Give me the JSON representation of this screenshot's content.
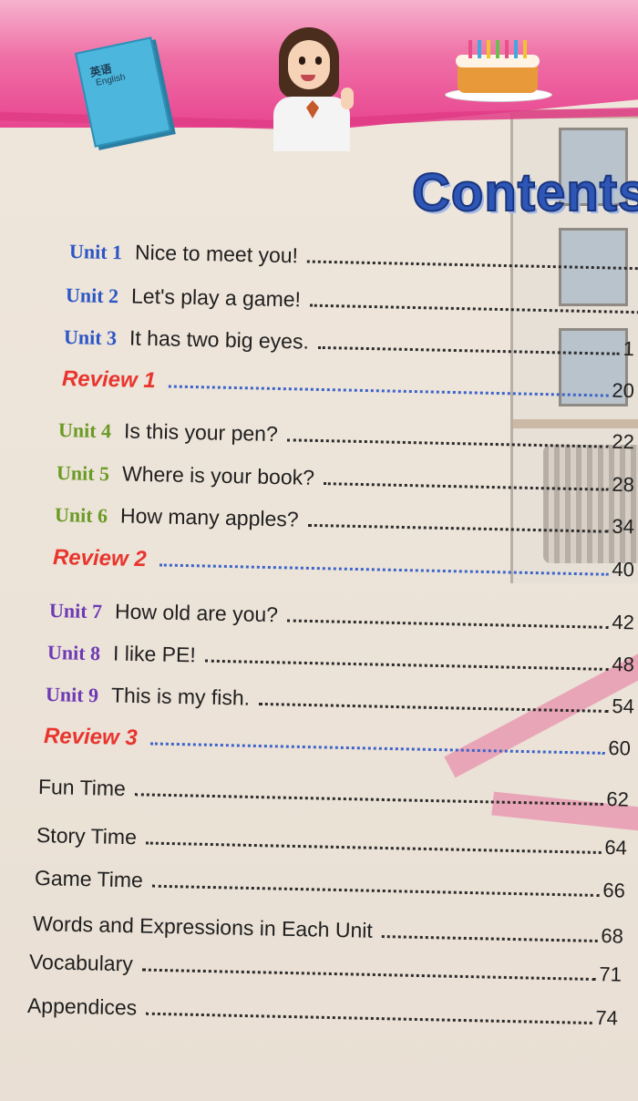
{
  "header": {
    "book_cover_title": "英语",
    "book_cover_subtitle": "English"
  },
  "title": "Contents",
  "toc": [
    {
      "label": "Unit 1",
      "title": "Nice to meet you!",
      "page": ""
    },
    {
      "label": "Unit 2",
      "title": "Let's play a game!",
      "page": ""
    },
    {
      "label": "Unit 3",
      "title": "It has two big eyes.",
      "page": "1"
    },
    {
      "label": "Review 1",
      "title": "",
      "page": "20"
    },
    {
      "label": "Unit 4",
      "title": "Is this your pen?",
      "page": "22"
    },
    {
      "label": "Unit 5",
      "title": "Where is your book?",
      "page": "28"
    },
    {
      "label": "Unit 6",
      "title": "How many apples?",
      "page": "34"
    },
    {
      "label": "Review 2",
      "title": "",
      "page": "40"
    },
    {
      "label": "Unit 7",
      "title": "How old are you?",
      "page": "42"
    },
    {
      "label": "Unit 8",
      "title": "I like PE!",
      "page": "48"
    },
    {
      "label": "Unit 9",
      "title": "This is my fish.",
      "page": "54"
    },
    {
      "label": "Review 3",
      "title": "",
      "page": "60"
    },
    {
      "label": "",
      "title": "Fun Time",
      "page": "62"
    },
    {
      "label": "",
      "title": "Story Time",
      "page": "64"
    },
    {
      "label": "",
      "title": "Game Time",
      "page": "66"
    },
    {
      "label": "",
      "title": "Words and Expressions in Each Unit",
      "page": "68"
    },
    {
      "label": "",
      "title": "Vocabulary",
      "page": "71"
    },
    {
      "label": "",
      "title": "Appendices",
      "page": "74"
    }
  ],
  "colors": {
    "unit_group_1": "#2c56c6",
    "unit_group_2": "#6a9b25",
    "unit_group_3": "#6e3ab4",
    "review": "#e8352e",
    "title": "#2d56b7",
    "banner": "#e84690"
  }
}
